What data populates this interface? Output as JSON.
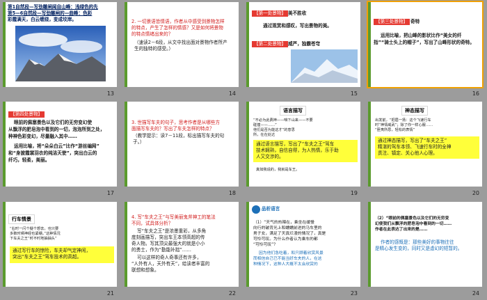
{
  "slides": [
    {
      "n": "13",
      "lines": [
        "第1自然段—写劲雕闸闻自山峰：浅绿色的先",
        "第5—6自然段—写劲雕闸的—曲峰：色彩",
        "彩霞满天，白云缠绕，变成坟岸。"
      ]
    },
    {
      "n": "14",
      "lines": [
        "2. 一切景语皆情语，作者从中感受到景物怎样",
        "的特点，产生了怎样的情感？又是如何将景物",
        "的特点情绪出来的？",
        "（速读2－6段，从文中找出面对景物作者所产",
        "生的独特的感受。）"
      ]
    },
    {
      "n": "15",
      "h1": "【第一处景物】",
      "h1r": "美不胜收",
      "p1": "通过观赏和感叹，写出景物的美。",
      "h2": "【第二处景物】",
      "h2r": "威严，独霸苍穹"
    },
    {
      "n": "16",
      "h": "【第三处景物】",
      "hr": "奇特",
      "lines": [
        "运用比喻，把山峰的影状比作“美女的纤",
        "指”“骑士头上的帽子”，写出了山峰形状的奇特。"
      ]
    },
    {
      "n": "17",
      "h": "【第四处景物】",
      "lines": [
        "眼前的佩塞景色以及它们的无穷变幻使",
        "从飘浮的肥皂泡中看到的一切，泡泡所到之处，",
        "种神色彩变幻，尽量融入其中……",
        "运用比喻，将“朵朵白云”比作“游丝编网”",
        "和“身披霞裳羽衣的纯洁天使”，突出白云的",
        "纤巧，轻柔，美丽。"
      ]
    },
    {
      "n": "18",
      "lines": [
        "3. 世描写车夫的句子，思考作者是从哪些方",
        "面描写车夫的？写出了车夫怎样的特点？",
        "（教学提示：读7－11段，标出描写车夫的句",
        "子。）"
      ]
    },
    {
      "n": "19",
      "head": "语言描写",
      "lines": [
        "“不必为此费神——咱下山来——不要",
        "碰撞——……”",
        "他们是否为能这才”的意思",
        "所，在在处达",
        "通过语言描写，写出了“车夫之王”驾车",
        "技术娴熟，自信自得，为人热情，乐于助",
        "人又交涉的。",
        "真如我说的，我就是车王。"
      ]
    },
    {
      "n": "20",
      "head": "神态描写",
      "lines": [
        "出发前，“把眉一扬：这个飞速行车",
        "时“神情威武”；除了你一样心服……",
        "“匪夷所思，轻松的表情”",
        "通过神态描写，写出了“车夫之王”",
        "精湛的驾车本领、飞速行车时的全神",
        "贯注、镇定、关心他人心理。"
      ]
    },
    {
      "n": "21",
      "head": "行车情景",
      "lines": [
        "“右时一闪个疑个想去，也只要",
        "多数时候神经也紧绷。”这种情况",
        "下车夫之王“时不时地抽抽头”",
        "通过写行车的惊险，车夫却气定神闲，",
        "突出“车夫之王”驾车技术的高超。"
      ]
    },
    {
      "n": "22",
      "lines": [
        "4. 写“车夫之王”与写美丽鬼斧神工的笔法",
        "不同，试具体分析？",
        "写“车夫之王”是浓墨重彩，从多角",
        "度刻画描写，突出车王本领高超的传",
        "奇人物。写其顶尖最强大的就是小小",
        "的勇士，作为“勤能补拙”……",
        "可以这样的奇人奇事还有许多，",
        "“人外有人，天外有天”，给读者丰富的",
        "联想和想象。"
      ]
    },
    {
      "n": "23",
      "head": "品析语言",
      "lines": [
        "（1）“天气的热辣在，乘坐在缓慢",
        "向行的破背光上和蠕蠕前进的马车里的",
        "男子女，满足了天真烂漫的情况了，真是",
        "可怜可叹。为什么作者认为乘车的都",
        "“可怜可叹”？",
        "因为他们急吃着，和只顾着欣赏风景",
        "而相信自己已不能当好车夫的人，在这",
        "种情况下，这种人大概不太会欣赏的"
      ]
    },
    {
      "n": "24",
      "lines": [
        "（2）“眼前的佩塞景色以及它们的无穷变",
        "幻使我们从飘浮的肥皂泡中看到的一切……",
        "作者在此表达了出来的是……",
        "作者的感慨是：那些美好的事物往往",
        "是精心发生变的，同时又是虚幻的短暂的。"
      ]
    }
  ]
}
